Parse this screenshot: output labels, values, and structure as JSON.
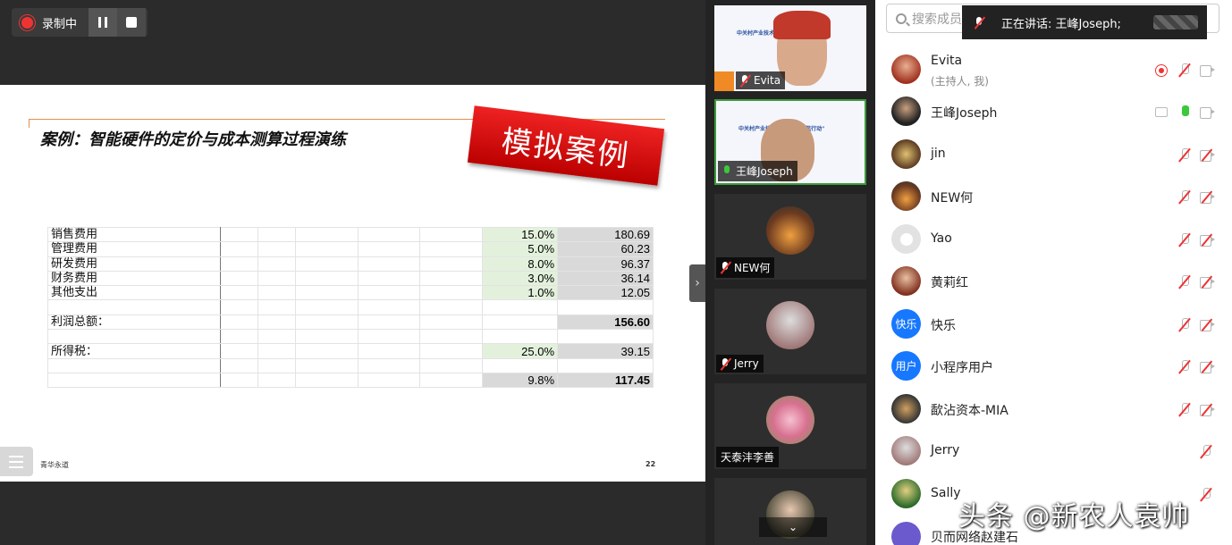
{
  "recording": {
    "label": "录制中"
  },
  "slide": {
    "title": "案例：智能硬件的定价与成本测算过程演练",
    "stamp": "模拟案例",
    "footer": "青华永道",
    "page": "22",
    "rows": [
      {
        "label": "销售费用",
        "pct": "15.0%",
        "value": "180.69"
      },
      {
        "label": "管理费用",
        "pct": "5.0%",
        "value": "60.23"
      },
      {
        "label": "研发费用",
        "pct": "8.0%",
        "value": "96.37"
      },
      {
        "label": "财务费用",
        "pct": "3.0%",
        "value": "36.14"
      },
      {
        "label": "其他支出",
        "pct": "1.0%",
        "value": "12.05"
      }
    ],
    "profit_label": "利润总额：",
    "profit_value": "156.60",
    "tax_label": "所得税：",
    "tax_pct": "25.0%",
    "tax_value": "39.15",
    "net_pct": "9.8%",
    "net_value": "117.45"
  },
  "videos": [
    {
      "name": "Evita"
    },
    {
      "name": "王峰Joseph"
    },
    {
      "name": "NEW何"
    },
    {
      "name": "Jerry"
    },
    {
      "name": "天泰沣李善"
    }
  ],
  "thumb_text": "中关村产业技术联盟\"联合护航行动\"",
  "panel": {
    "search_placeholder": "搜索成员",
    "speaking": "正在讲话: 王峰Joseph;",
    "members": [
      {
        "name": "Evita",
        "sub": "(主持人, 我)"
      },
      {
        "name": "王峰Joseph"
      },
      {
        "name": "jin"
      },
      {
        "name": "NEW何"
      },
      {
        "name": "Yao"
      },
      {
        "name": "黄莉红"
      },
      {
        "name": "快乐",
        "avatar_text": "快乐"
      },
      {
        "name": "小程序用户",
        "avatar_text": "用户"
      },
      {
        "name": "歃沾资本-MIA"
      },
      {
        "name": "Jerry"
      },
      {
        "name": "Sally"
      },
      {
        "name": "贝而网络赵建石"
      }
    ]
  },
  "watermark": "头条 @新农人袁帅"
}
